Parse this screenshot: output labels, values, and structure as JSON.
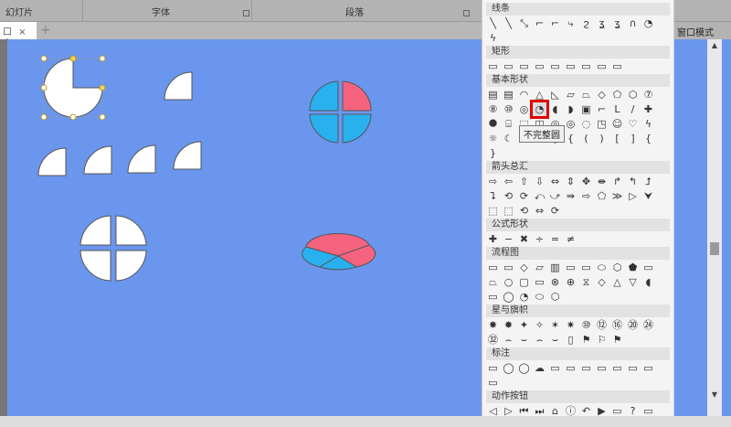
{
  "ribbon": {
    "groups": [
      "幻灯片",
      "字体",
      "段落"
    ]
  },
  "tabbar": {
    "tab_label": "口",
    "close": "×",
    "more": "⋮",
    "add": "+"
  },
  "right": {
    "window_mode": "窗口模式"
  },
  "panel": {
    "sections": [
      {
        "title": "线条",
        "icons": [
          "╲",
          "╲",
          "⤡",
          "⌐",
          "⌐",
          "⤷",
          "ϩ",
          "ʓ",
          "ʓ",
          "∩",
          "◔",
          "ϟ"
        ]
      },
      {
        "title": "矩形",
        "icons": [
          "▭",
          "▭",
          "▭",
          "▭",
          "▭",
          "▭",
          "▭",
          "▭",
          "▭"
        ]
      },
      {
        "title": "基本形状",
        "icons": [
          "▤",
          "▤",
          "◠",
          "△",
          "◺",
          "▱",
          "⏢",
          "◇",
          "⬠",
          "⬡",
          "⑦",
          "⑧",
          "⑩",
          "◎",
          "◔",
          "◖",
          "◗",
          "▣",
          "⌐",
          "L",
          "∕",
          "✚",
          "⯃",
          "⌸",
          "⬚",
          "◫",
          "◎",
          "◎",
          "◌",
          "◳",
          "☺",
          "♡",
          "ϟ",
          "☼",
          "☾",
          "☁",
          "⌒",
          "[",
          "{",
          "(",
          ")",
          "[",
          "]",
          "{",
          "}"
        ]
      },
      {
        "title": "箭头总汇",
        "icons": [
          "⇨",
          "⇦",
          "⇧",
          "⇩",
          "⇔",
          "⇕",
          "✥",
          "⇼",
          "↱",
          "↰",
          "⮥",
          "⮧",
          "⟲",
          "⟳",
          "⤺",
          "⤻",
          "⇛",
          "⇨",
          "⬠",
          "≫",
          "▷",
          "⮟",
          "⬚",
          "⬚",
          "⟲",
          "⇔",
          "⟳"
        ]
      },
      {
        "title": "公式形状",
        "icons": [
          "✚",
          "−",
          "✖",
          "÷",
          "=",
          "≠"
        ]
      },
      {
        "title": "流程图",
        "icons": [
          "▭",
          "▭",
          "◇",
          "▱",
          "▥",
          "▭",
          "▭",
          "⬭",
          "⬡",
          "⬟",
          "▭",
          "⏢",
          "○",
          "▢",
          "▭",
          "⊗",
          "⊕",
          "⧖",
          "◇",
          "△",
          "▽",
          "◖",
          "▭",
          "◯",
          "◔",
          "⬭",
          "⬡"
        ]
      },
      {
        "title": "星与旗帜",
        "icons": [
          "✸",
          "✹",
          "✦",
          "✧",
          "✶",
          "✷",
          "⑩",
          "⑫",
          "⑯",
          "⑳",
          "㉔",
          "㉜",
          "⌢",
          "⌣",
          "⌢",
          "⌣",
          "▯",
          "⚑",
          "⚐",
          "⚑"
        ]
      },
      {
        "title": "标注",
        "icons": [
          "▭",
          "◯",
          "◯",
          "☁",
          "▭",
          "▭",
          "▭",
          "▭",
          "▭",
          "▭",
          "▭",
          "▭"
        ]
      },
      {
        "title": "动作按钮",
        "icons": [
          "◁",
          "▷",
          "⏮",
          "⏭",
          "⌂",
          "ⓘ",
          "↶",
          "▶",
          "▭",
          "?",
          "▭"
        ]
      }
    ],
    "selected_index": 14,
    "tooltip": "不完整圆"
  },
  "colors": {
    "canvas": "#6b96ee",
    "blue": "#29b0ef",
    "pink": "#f6637f"
  }
}
